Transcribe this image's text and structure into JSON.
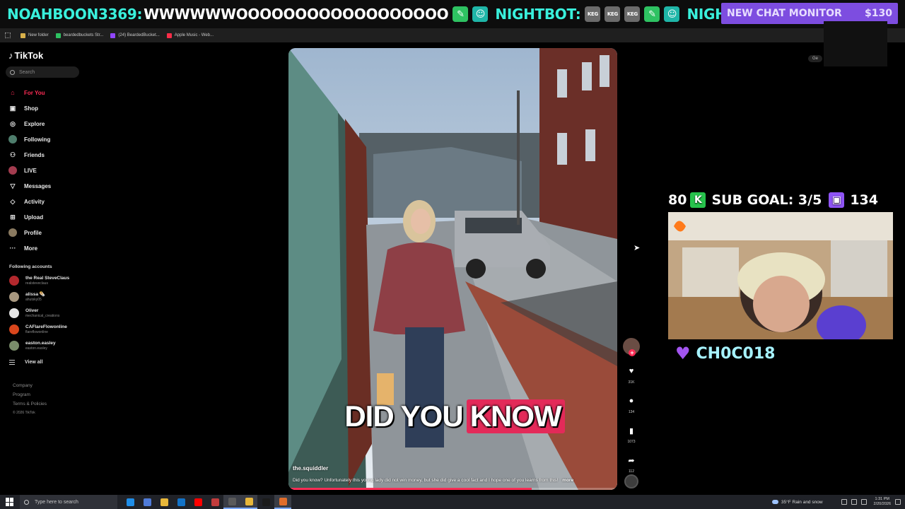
{
  "ticker": {
    "user1": "NOAHBOON3369:",
    "msg1": "WWWWWWOOOOOOOOOOOOOOOOOO",
    "user2": "NIGHTBOT:",
    "user3": "NIGHTBO",
    "chat_monitor_label": "NEW CHAT MONITOR",
    "chat_monitor_amount": "$130"
  },
  "bookmarks": [
    {
      "label": "New folder",
      "color": "#d8b04a"
    },
    {
      "label": "beardedbuckets Str...",
      "color": "#2ec262"
    },
    {
      "label": "(24) BeardedBucket...",
      "color": "#9146ff"
    },
    {
      "label": "Apple Music - Web...",
      "color": "#fa2d48"
    }
  ],
  "tiktok": {
    "logo": "TikTok",
    "search_placeholder": "Search",
    "nav": [
      {
        "label": "For You",
        "icon": "home-icon",
        "glyph": "⌂"
      },
      {
        "label": "Shop",
        "icon": "bag-icon",
        "glyph": "▣"
      },
      {
        "label": "Explore",
        "icon": "compass-icon",
        "glyph": "◎"
      },
      {
        "label": "Following",
        "icon": "avatar-icon",
        "glyph": ""
      },
      {
        "label": "Friends",
        "icon": "friends-icon",
        "glyph": "⚇"
      },
      {
        "label": "LIVE",
        "icon": "live-avatar-icon",
        "glyph": ""
      },
      {
        "label": "Messages",
        "icon": "messages-icon",
        "glyph": "▽"
      },
      {
        "label": "Activity",
        "icon": "activity-icon",
        "glyph": "◇"
      },
      {
        "label": "Upload",
        "icon": "upload-icon",
        "glyph": "⊞"
      },
      {
        "label": "Profile",
        "icon": "profile-avatar-icon",
        "glyph": ""
      },
      {
        "label": "More",
        "icon": "more-icon",
        "glyph": "···"
      }
    ],
    "following_title": "Following accounts",
    "accounts": [
      {
        "name": "the Real SteveClaus",
        "handle": "realsteveclaus",
        "color": "#b3282d"
      },
      {
        "name": "alissa 🌯",
        "handle": "ahutsky05",
        "color": "#a89880"
      },
      {
        "name": "Oliver",
        "handle": "mechanical_creations",
        "color": "#e5e5e5"
      },
      {
        "name": "CAFlareFlowonline",
        "handle": "flareflowonline",
        "color": "#d9461c"
      },
      {
        "name": "easton.easley",
        "handle": "easton.easley",
        "color": "#7a8d6b"
      }
    ],
    "view_all": "View all",
    "footer": [
      "Company",
      "Program",
      "Terms & Policies"
    ],
    "copyright": "© 2026 TikTok"
  },
  "video": {
    "caption_words": [
      "DID",
      "YOU",
      "KNOW"
    ],
    "highlight_word": "KNOW",
    "username": "the.squiddler",
    "description": "Did you know? Unfortunately this young lady did not win money, but she did give a cool fact and I hope one of you learns from this!",
    "more": "more",
    "progress": 0.74,
    "likes": "31K",
    "comments": "134",
    "saves": "1073",
    "shares": "112"
  },
  "overlay": {
    "goal_left": "80",
    "goal_label": "SUB GOAL: 3/5",
    "goal_right": "134",
    "subscriber": "CH0C018",
    "side_pill": "Ge"
  },
  "taskbar": {
    "search_placeholder": "Type here to search",
    "weather": "35°F Rain and snow",
    "time": "1:31 PM",
    "date": "2/20/2026",
    "apps": [
      {
        "name": "edge-icon",
        "color": "#1f8ee8",
        "on": false
      },
      {
        "name": "copilot-icon",
        "color": "#4f7bd8",
        "on": false
      },
      {
        "name": "file-explorer-icon",
        "color": "#e8b73a",
        "on": false
      },
      {
        "name": "outlook-icon",
        "color": "#1373c8",
        "on": false
      },
      {
        "name": "youtube-icon",
        "color": "#ff0000",
        "on": false
      },
      {
        "name": "app-icon",
        "color": "#c23c3c",
        "on": false
      },
      {
        "name": "obs-icon",
        "color": "#5a5a5a",
        "on": true
      },
      {
        "name": "chrome-icon",
        "color": "#e8b73a",
        "on": true
      },
      {
        "name": "tiktok-icon",
        "color": "#1b1b1b",
        "on": false
      },
      {
        "name": "app2-icon",
        "color": "#e06d2b",
        "on": true
      }
    ]
  }
}
